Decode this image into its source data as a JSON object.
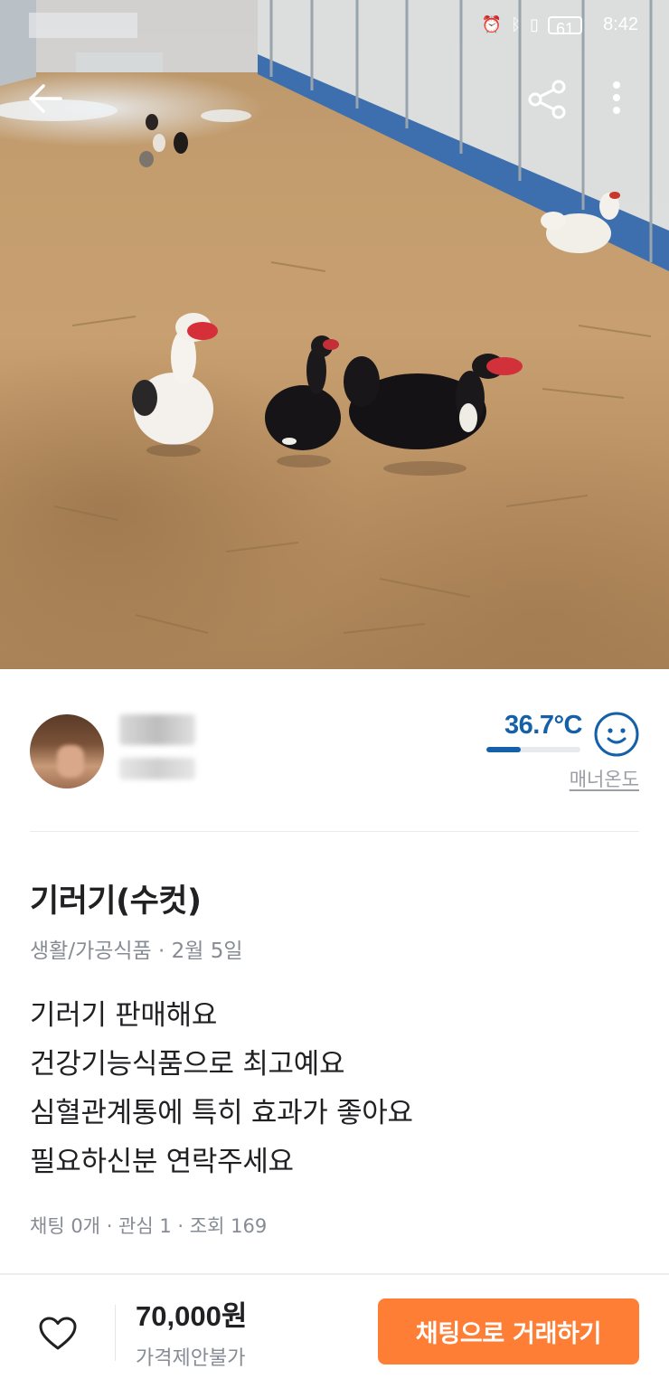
{
  "status_bar": {
    "time": "8:42",
    "battery": "61",
    "icons": [
      "alarm-icon",
      "bluetooth-icon",
      "vibrate-icon",
      "battery-icon"
    ]
  },
  "header": {
    "icons": [
      "back-arrow-icon",
      "share-icon",
      "more-vertical-icon"
    ]
  },
  "seller": {
    "temperature": "36.7°C",
    "temperature_value": 36.7,
    "manner_label": "매너온도",
    "accent_color": "#1561a9"
  },
  "post": {
    "title": "기러기(수컷)",
    "category": "생활/가공식품",
    "date": "2월 5일",
    "body_lines": [
      "기러기 판매해요",
      "건강기능식품으로 최고예요",
      "심혈관계통에 특히 효과가 좋아요",
      "필요하신분 연락주세요"
    ],
    "stats": {
      "chats": "채팅 0개",
      "likes": "관심 1",
      "views": "조회 169"
    }
  },
  "bottom_bar": {
    "price": "70,000원",
    "price_note": "가격제안불가",
    "chat_button_label": "채팅으로 거래하기",
    "chat_button_color": "#ff7e36"
  }
}
